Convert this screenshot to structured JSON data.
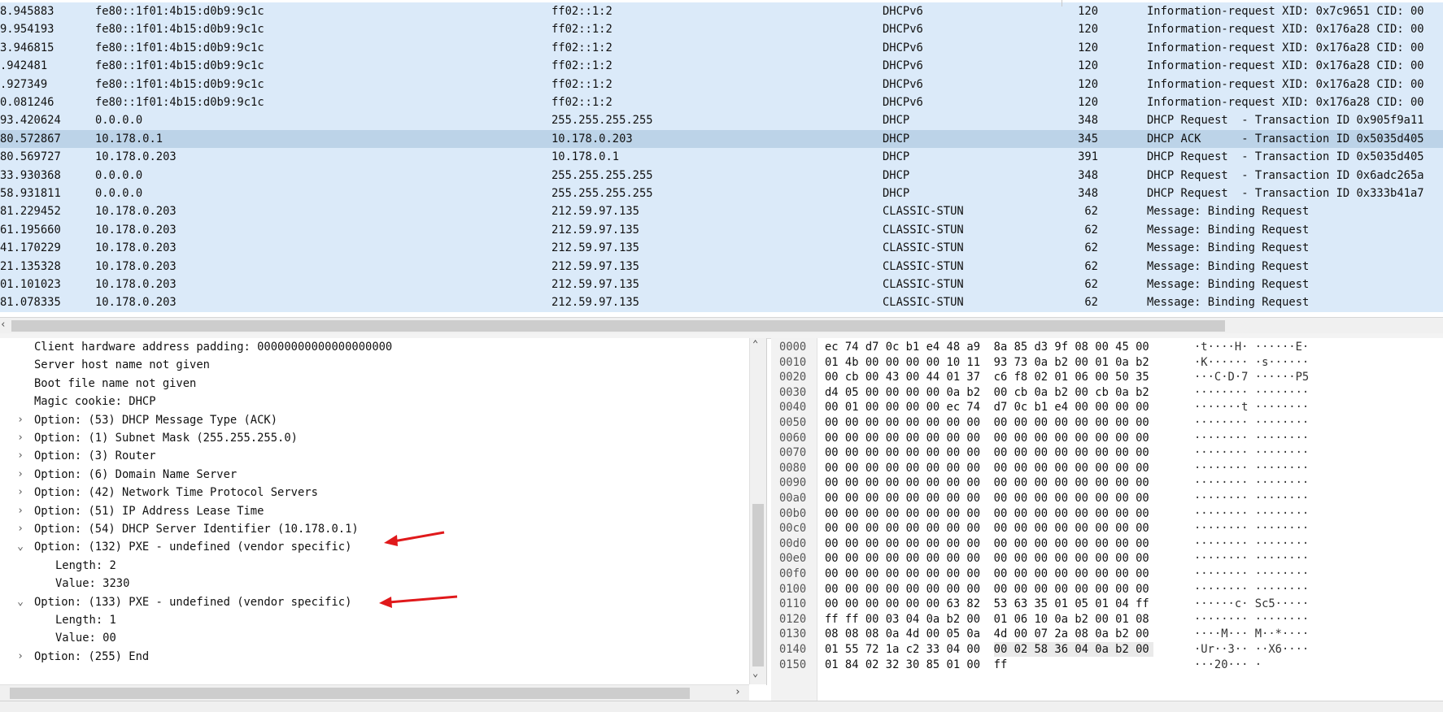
{
  "packet_list": {
    "rows": [
      {
        "time": "8.945883",
        "src": "fe80::1f01:4b15:d0b9:9c1c",
        "dst": "ff02::1:2",
        "proto": "DHCPv6",
        "len": "120",
        "info": "Information-request XID: 0x7c9651 CID: 00"
      },
      {
        "time": "9.954193",
        "src": "fe80::1f01:4b15:d0b9:9c1c",
        "dst": "ff02::1:2",
        "proto": "DHCPv6",
        "len": "120",
        "info": "Information-request XID: 0x176a28 CID: 00"
      },
      {
        "time": "3.946815",
        "src": "fe80::1f01:4b15:d0b9:9c1c",
        "dst": "ff02::1:2",
        "proto": "DHCPv6",
        "len": "120",
        "info": "Information-request XID: 0x176a28 CID: 00"
      },
      {
        "time": ".942481",
        "src": "fe80::1f01:4b15:d0b9:9c1c",
        "dst": "ff02::1:2",
        "proto": "DHCPv6",
        "len": "120",
        "info": "Information-request XID: 0x176a28 CID: 00"
      },
      {
        "time": ".927349",
        "src": "fe80::1f01:4b15:d0b9:9c1c",
        "dst": "ff02::1:2",
        "proto": "DHCPv6",
        "len": "120",
        "info": "Information-request XID: 0x176a28 CID: 00"
      },
      {
        "time": "0.081246",
        "src": "fe80::1f01:4b15:d0b9:9c1c",
        "dst": "ff02::1:2",
        "proto": "DHCPv6",
        "len": "120",
        "info": "Information-request XID: 0x176a28 CID: 00"
      },
      {
        "time": "93.420624",
        "src": "0.0.0.0",
        "dst": "255.255.255.255",
        "proto": "DHCP",
        "len": "348",
        "info": "DHCP Request  - Transaction ID 0x905f9a11"
      },
      {
        "time": "80.572867",
        "src": "10.178.0.1",
        "dst": "10.178.0.203",
        "proto": "DHCP",
        "len": "345",
        "info": "DHCP ACK      - Transaction ID 0x5035d405"
      },
      {
        "time": "80.569727",
        "src": "10.178.0.203",
        "dst": "10.178.0.1",
        "proto": "DHCP",
        "len": "391",
        "info": "DHCP Request  - Transaction ID 0x5035d405"
      },
      {
        "time": "33.930368",
        "src": "0.0.0.0",
        "dst": "255.255.255.255",
        "proto": "DHCP",
        "len": "348",
        "info": "DHCP Request  - Transaction ID 0x6adc265a"
      },
      {
        "time": "58.931811",
        "src": "0.0.0.0",
        "dst": "255.255.255.255",
        "proto": "DHCP",
        "len": "348",
        "info": "DHCP Request  - Transaction ID 0x333b41a7"
      },
      {
        "time": "81.229452",
        "src": "10.178.0.203",
        "dst": "212.59.97.135",
        "proto": "CLASSIC-STUN",
        "len": "62",
        "info": "Message: Binding Request"
      },
      {
        "time": "61.195660",
        "src": "10.178.0.203",
        "dst": "212.59.97.135",
        "proto": "CLASSIC-STUN",
        "len": "62",
        "info": "Message: Binding Request"
      },
      {
        "time": "41.170229",
        "src": "10.178.0.203",
        "dst": "212.59.97.135",
        "proto": "CLASSIC-STUN",
        "len": "62",
        "info": "Message: Binding Request"
      },
      {
        "time": "21.135328",
        "src": "10.178.0.203",
        "dst": "212.59.97.135",
        "proto": "CLASSIC-STUN",
        "len": "62",
        "info": "Message: Binding Request"
      },
      {
        "time": "01.101023",
        "src": "10.178.0.203",
        "dst": "212.59.97.135",
        "proto": "CLASSIC-STUN",
        "len": "62",
        "info": "Message: Binding Request"
      },
      {
        "time": "81.078335",
        "src": "10.178.0.203",
        "dst": "212.59.97.135",
        "proto": "CLASSIC-STUN",
        "len": "62",
        "info": "Message: Binding Request"
      }
    ],
    "selected_index": 7,
    "colors": {
      "row_bg": "#dbeaf9",
      "selected_bg": "#bcd3e8"
    }
  },
  "details": {
    "lines": [
      {
        "text": "Client hardware address padding: 00000000000000000000",
        "indent": 1,
        "expander": ""
      },
      {
        "text": "Server host name not given",
        "indent": 1,
        "expander": ""
      },
      {
        "text": "Boot file name not given",
        "indent": 1,
        "expander": ""
      },
      {
        "text": "Magic cookie: DHCP",
        "indent": 1,
        "expander": ""
      },
      {
        "text": "Option: (53) DHCP Message Type (ACK)",
        "indent": 1,
        "expander": "collapsed"
      },
      {
        "text": "Option: (1) Subnet Mask (255.255.255.0)",
        "indent": 1,
        "expander": "collapsed"
      },
      {
        "text": "Option: (3) Router",
        "indent": 1,
        "expander": "collapsed"
      },
      {
        "text": "Option: (6) Domain Name Server",
        "indent": 1,
        "expander": "collapsed"
      },
      {
        "text": "Option: (42) Network Time Protocol Servers",
        "indent": 1,
        "expander": "collapsed"
      },
      {
        "text": "Option: (51) IP Address Lease Time",
        "indent": 1,
        "expander": "collapsed"
      },
      {
        "text": "Option: (54) DHCP Server Identifier (10.178.0.1)",
        "indent": 1,
        "expander": "collapsed"
      },
      {
        "text": "Option: (132) PXE - undefined (vendor specific)",
        "indent": 1,
        "expander": "expanded",
        "annotated": true
      },
      {
        "text": "Length: 2",
        "indent": 2,
        "expander": ""
      },
      {
        "text": "Value: 3230",
        "indent": 2,
        "expander": ""
      },
      {
        "text": "Option: (133) PXE - undefined (vendor specific)",
        "indent": 1,
        "expander": "expanded",
        "annotated": true
      },
      {
        "text": "Length: 1",
        "indent": 2,
        "expander": ""
      },
      {
        "text": "Value: 00",
        "indent": 2,
        "expander": ""
      },
      {
        "text": "Option: (255) End",
        "indent": 1,
        "expander": "collapsed"
      }
    ],
    "annotation_color": "#e0191b"
  },
  "bytes": {
    "lines": [
      {
        "off": "0000",
        "hex": "ec 74 d7 0c b1 e4 48 a9  8a 85 d3 9f 08 00 45 00",
        "ascii": "·t····H· ······E·"
      },
      {
        "off": "0010",
        "hex": "01 4b 00 00 00 00 10 11  93 73 0a b2 00 01 0a b2",
        "ascii": "·K······ ·s······"
      },
      {
        "off": "0020",
        "hex": "00 cb 00 43 00 44 01 37  c6 f8 02 01 06 00 50 35",
        "ascii": "···C·D·7 ······P5"
      },
      {
        "off": "0030",
        "hex": "d4 05 00 00 00 00 0a b2  00 cb 0a b2 00 cb 0a b2",
        "ascii": "········ ········"
      },
      {
        "off": "0040",
        "hex": "00 01 00 00 00 00 ec 74  d7 0c b1 e4 00 00 00 00",
        "ascii": "·······t ········"
      },
      {
        "off": "0050",
        "hex": "00 00 00 00 00 00 00 00  00 00 00 00 00 00 00 00",
        "ascii": "········ ········"
      },
      {
        "off": "0060",
        "hex": "00 00 00 00 00 00 00 00  00 00 00 00 00 00 00 00",
        "ascii": "········ ········"
      },
      {
        "off": "0070",
        "hex": "00 00 00 00 00 00 00 00  00 00 00 00 00 00 00 00",
        "ascii": "········ ········"
      },
      {
        "off": "0080",
        "hex": "00 00 00 00 00 00 00 00  00 00 00 00 00 00 00 00",
        "ascii": "········ ········"
      },
      {
        "off": "0090",
        "hex": "00 00 00 00 00 00 00 00  00 00 00 00 00 00 00 00",
        "ascii": "········ ········"
      },
      {
        "off": "00a0",
        "hex": "00 00 00 00 00 00 00 00  00 00 00 00 00 00 00 00",
        "ascii": "········ ········"
      },
      {
        "off": "00b0",
        "hex": "00 00 00 00 00 00 00 00  00 00 00 00 00 00 00 00",
        "ascii": "········ ········"
      },
      {
        "off": "00c0",
        "hex": "00 00 00 00 00 00 00 00  00 00 00 00 00 00 00 00",
        "ascii": "········ ········"
      },
      {
        "off": "00d0",
        "hex": "00 00 00 00 00 00 00 00  00 00 00 00 00 00 00 00",
        "ascii": "········ ········"
      },
      {
        "off": "00e0",
        "hex": "00 00 00 00 00 00 00 00  00 00 00 00 00 00 00 00",
        "ascii": "········ ········"
      },
      {
        "off": "00f0",
        "hex": "00 00 00 00 00 00 00 00  00 00 00 00 00 00 00 00",
        "ascii": "········ ········"
      },
      {
        "off": "0100",
        "hex": "00 00 00 00 00 00 00 00  00 00 00 00 00 00 00 00",
        "ascii": "········ ········"
      },
      {
        "off": "0110",
        "hex": "00 00 00 00 00 00 63 82  53 63 35 01 05 01 04 ff",
        "ascii": "······c· Sc5·····"
      },
      {
        "off": "0120",
        "hex": "ff ff 00 03 04 0a b2 00  01 06 10 0a b2 00 01 08",
        "ascii": "········ ········"
      },
      {
        "off": "0130",
        "hex": "08 08 08 0a 4d 00 05 0a  4d 00 07 2a 08 0a b2 00",
        "ascii": "····M··· M··*····"
      },
      {
        "off": "0140",
        "hex": "01 55 72 1a c2 33 04 00  00 02 58 36 04 0a b2 00",
        "ascii": "·Ur··3·· ··X6····"
      },
      {
        "off": "0150",
        "hex": "01 84 02 32 30 85 01 00  ff",
        "ascii": "···20··· ·"
      }
    ]
  }
}
